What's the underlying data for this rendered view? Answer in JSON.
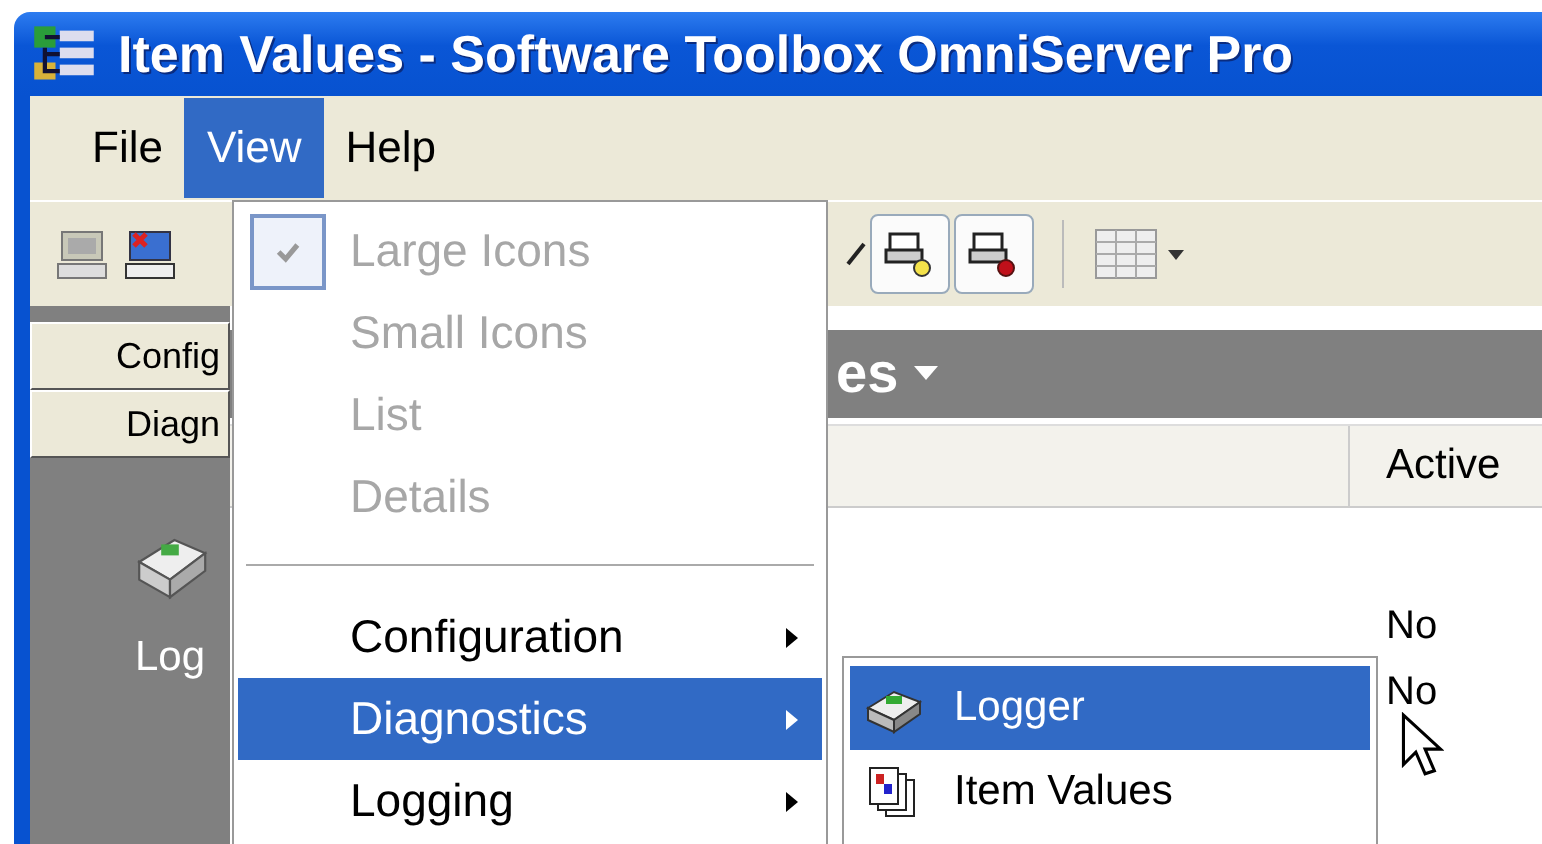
{
  "window": {
    "title": "Item Values - Software Toolbox OmniServer Pro"
  },
  "menu_bar": [
    {
      "label": "File",
      "selected": false
    },
    {
      "label": "View",
      "selected": true
    },
    {
      "label": "Help",
      "selected": false
    }
  ],
  "sidebar": {
    "buttons": [
      "Config",
      "Diagn"
    ],
    "items": [
      {
        "label": "Log"
      }
    ]
  },
  "content": {
    "header": "es",
    "columns": [
      "Active"
    ],
    "rows": [
      {
        "active": "No"
      },
      {
        "active": "No"
      }
    ]
  },
  "view_menu": {
    "items": [
      {
        "kind": "item",
        "label": "Large Icons",
        "checked": true,
        "disabled": true,
        "selected": false
      },
      {
        "kind": "item",
        "label": "Small Icons",
        "checked": false,
        "disabled": true,
        "selected": false
      },
      {
        "kind": "item",
        "label": "List",
        "checked": false,
        "disabled": true,
        "selected": false
      },
      {
        "kind": "item",
        "label": "Details",
        "checked": false,
        "disabled": true,
        "selected": false
      },
      {
        "kind": "separator"
      },
      {
        "kind": "submenu",
        "label": "Configuration",
        "selected": false
      },
      {
        "kind": "submenu",
        "label": "Diagnostics",
        "selected": true
      },
      {
        "kind": "submenu",
        "label": "Logging",
        "selected": false
      }
    ]
  },
  "submenu": {
    "items": [
      {
        "kind": "logger",
        "label": "Logger",
        "selected": true
      },
      {
        "kind": "values",
        "label": "Item Values",
        "selected": false
      }
    ]
  }
}
